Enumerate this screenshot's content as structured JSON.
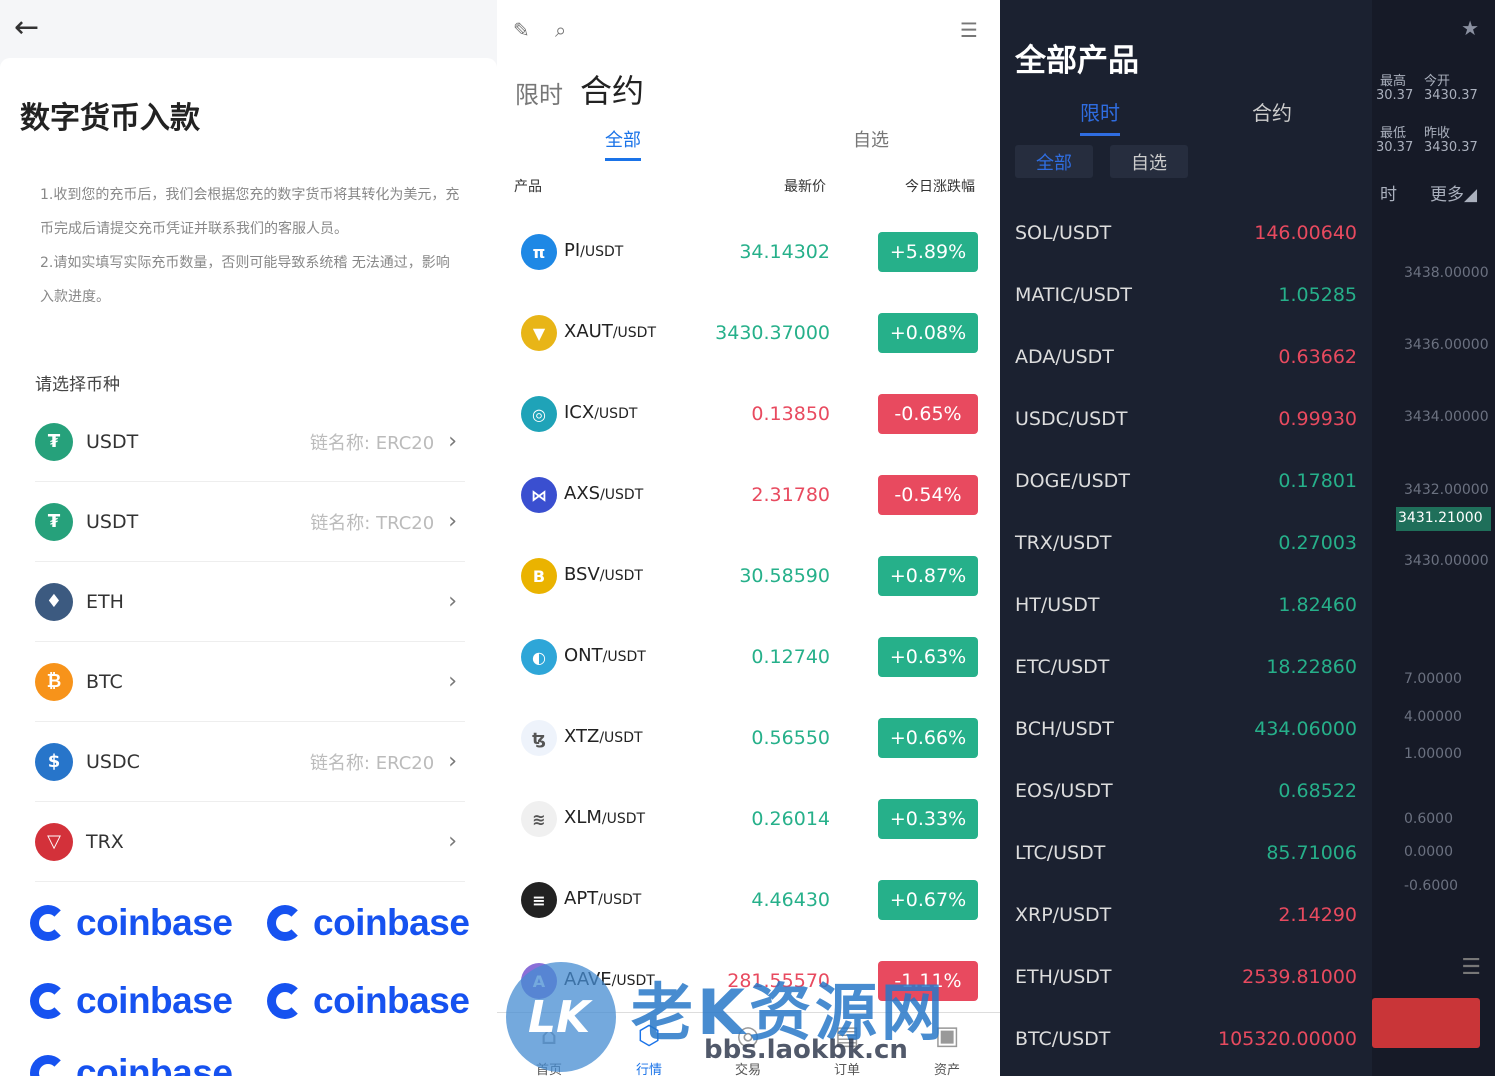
{
  "deposit": {
    "title": "数字货币入款",
    "note1": "1.收到您的充币后，我们会根据您充的数字货币将其转化为美元，充币完成后请提交充币凭证并联系我们的客服人员。",
    "note2": "2.请如实填写实际充币数量，否则可能导致系统稽 无法通过，影响入款进度。",
    "choose_label": "请选择币种",
    "coins": [
      {
        "name": "USDT",
        "chain": "链名称: ERC20",
        "color": "#26a17b",
        "glyph": "₮"
      },
      {
        "name": "USDT",
        "chain": "链名称: TRC20",
        "color": "#26a17b",
        "glyph": "₮"
      },
      {
        "name": "ETH",
        "chain": "",
        "color": "#3c5a80",
        "glyph": "♦"
      },
      {
        "name": "BTC",
        "chain": "",
        "color": "#f7931a",
        "glyph": "₿"
      },
      {
        "name": "USDC",
        "chain": "链名称: ERC20",
        "color": "#2775ca",
        "glyph": "$"
      },
      {
        "name": "TRX",
        "chain": "",
        "color": "#d3313a",
        "glyph": "▽"
      }
    ],
    "brand": "coinbase"
  },
  "market": {
    "tab_limit": "限时",
    "tab_contract": "合约",
    "sub_all": "全部",
    "sub_fav": "自选",
    "col_product": "产品",
    "col_price": "最新价",
    "col_change": "今日涨跌幅",
    "rows": [
      {
        "base": "PI",
        "quote": "/USDT",
        "price": "34.14302",
        "change": "+5.89%",
        "dir": "up",
        "color": "#1e88e5",
        "glyph": "π"
      },
      {
        "base": "XAUT",
        "quote": "/USDT",
        "price": "3430.37000",
        "change": "+0.08%",
        "dir": "up",
        "color": "#e8b517",
        "glyph": "▼"
      },
      {
        "base": "ICX",
        "quote": "/USDT",
        "price": "0.13850",
        "change": "-0.65%",
        "dir": "down",
        "color": "#1fa3b8",
        "glyph": "◎"
      },
      {
        "base": "AXS",
        "quote": "/USDT",
        "price": "2.31780",
        "change": "-0.54%",
        "dir": "down",
        "color": "#3a4fd0",
        "glyph": "⋈"
      },
      {
        "base": "BSV",
        "quote": "/USDT",
        "price": "30.58590",
        "change": "+0.87%",
        "dir": "up",
        "color": "#eab300",
        "glyph": "B"
      },
      {
        "base": "ONT",
        "quote": "/USDT",
        "price": "0.12740",
        "change": "+0.63%",
        "dir": "up",
        "color": "#2ea6d8",
        "glyph": "◐"
      },
      {
        "base": "XTZ",
        "quote": "/USDT",
        "price": "0.56550",
        "change": "+0.66%",
        "dir": "up",
        "color": "#eef3fb",
        "glyph": "ꜩ"
      },
      {
        "base": "XLM",
        "quote": "/USDT",
        "price": "0.26014",
        "change": "+0.33%",
        "dir": "up",
        "color": "#f0f0f0",
        "glyph": "≋"
      },
      {
        "base": "APT",
        "quote": "/USDT",
        "price": "4.46430",
        "change": "+0.67%",
        "dir": "up",
        "color": "#222222",
        "glyph": "≡"
      },
      {
        "base": "AAVE",
        "quote": "/USDT",
        "price": "281.55570",
        "change": "-1.11%",
        "dir": "down",
        "color": "#8a6fd8",
        "glyph": "A"
      }
    ],
    "nav": [
      "首页",
      "行情",
      "交易",
      "订单",
      "资产"
    ]
  },
  "drawer": {
    "title": "全部产品",
    "tab_limit": "限时",
    "tab_contract": "合约",
    "chip_all": "全部",
    "chip_fav": "自选",
    "rows": [
      {
        "sym": "SOL/USDT",
        "price": "146.00640",
        "dir": "down"
      },
      {
        "sym": "MATIC/USDT",
        "price": "1.05285",
        "dir": "up"
      },
      {
        "sym": "ADA/USDT",
        "price": "0.63662",
        "dir": "down"
      },
      {
        "sym": "USDC/USDT",
        "price": "0.99930",
        "dir": "down"
      },
      {
        "sym": "DOGE/USDT",
        "price": "0.17801",
        "dir": "up"
      },
      {
        "sym": "TRX/USDT",
        "price": "0.27003",
        "dir": "up"
      },
      {
        "sym": "HT/USDT",
        "price": "1.82460",
        "dir": "up"
      },
      {
        "sym": "ETC/USDT",
        "price": "18.22860",
        "dir": "up"
      },
      {
        "sym": "BCH/USDT",
        "price": "434.06000",
        "dir": "up"
      },
      {
        "sym": "EOS/USDT",
        "price": "0.68522",
        "dir": "up"
      },
      {
        "sym": "LTC/USDT",
        "price": "85.71006",
        "dir": "up"
      },
      {
        "sym": "XRP/USDT",
        "price": "2.14290",
        "dir": "down"
      },
      {
        "sym": "ETH/USDT",
        "price": "2539.81000",
        "dir": "down"
      },
      {
        "sym": "BTC/USDT",
        "price": "105320.00000",
        "dir": "down"
      }
    ]
  },
  "chart_bg": {
    "labels": [
      {
        "t": "最高"
      },
      {
        "t": "今开"
      },
      {
        "t": "30.37"
      },
      {
        "t": "3430.37"
      },
      {
        "t": "最低"
      },
      {
        "t": "昨收"
      },
      {
        "t": "30.37"
      },
      {
        "t": "3430.37"
      },
      {
        "t": "时"
      },
      {
        "t": "更多◢"
      },
      {
        "t": "3438.00000"
      },
      {
        "t": "3436.00000"
      },
      {
        "t": "3434.00000"
      },
      {
        "t": "3432.00000"
      },
      {
        "t": "3431.21000"
      },
      {
        "t": "3430.00000"
      },
      {
        "t": "7.00000"
      },
      {
        "t": "4.00000"
      },
      {
        "t": "1.00000"
      },
      {
        "t": "0.6000"
      },
      {
        "t": "0.0000"
      },
      {
        "t": "-0.6000"
      }
    ]
  },
  "watermark": {
    "badge": "LK",
    "text": "老K资源网",
    "url": "bbs.laokbk.cn"
  }
}
